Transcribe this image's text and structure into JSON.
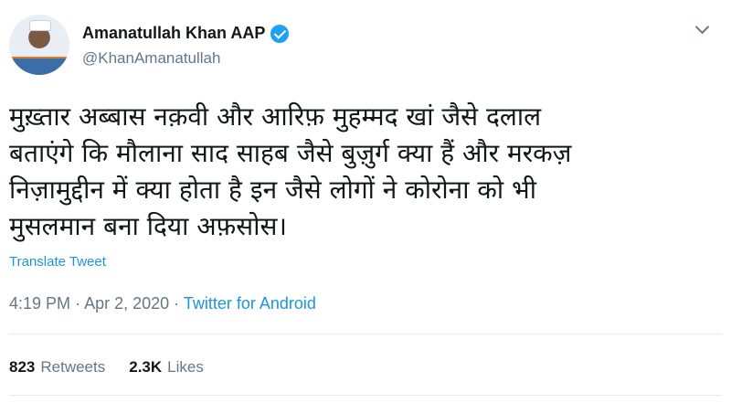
{
  "user": {
    "name": "Amanatullah Khan AAP",
    "handle": "@KhanAmanatullah",
    "avatar_icon": "profile-photo"
  },
  "tweet": {
    "lines": [
      "मुख़्तार अब्बास नक़वी और आरिफ़ मुहम्मद खां जैसे दलाल",
      "बताएंगे कि मौलाना साद साहब जैसे बुज़ुर्ग क्या हैं और मरकज़",
      "निज़ामुद्दीन में क्या होता है इन जैसे लोगों ने कोरोना को भी",
      "मुसलमान बना दिया अफ़सोस।"
    ],
    "translate_label": "Translate Tweet",
    "time": "4:19 PM",
    "date": "Apr 2, 2020",
    "separator": "·",
    "source": "Twitter for Android"
  },
  "stats": {
    "retweets_count": "823",
    "retweets_label": "Retweets",
    "likes_count": "2.3K",
    "likes_label": "Likes"
  },
  "colors": {
    "link_blue": "#1b95e0",
    "verified_blue": "#1da1f2",
    "muted_gray": "#657786"
  }
}
